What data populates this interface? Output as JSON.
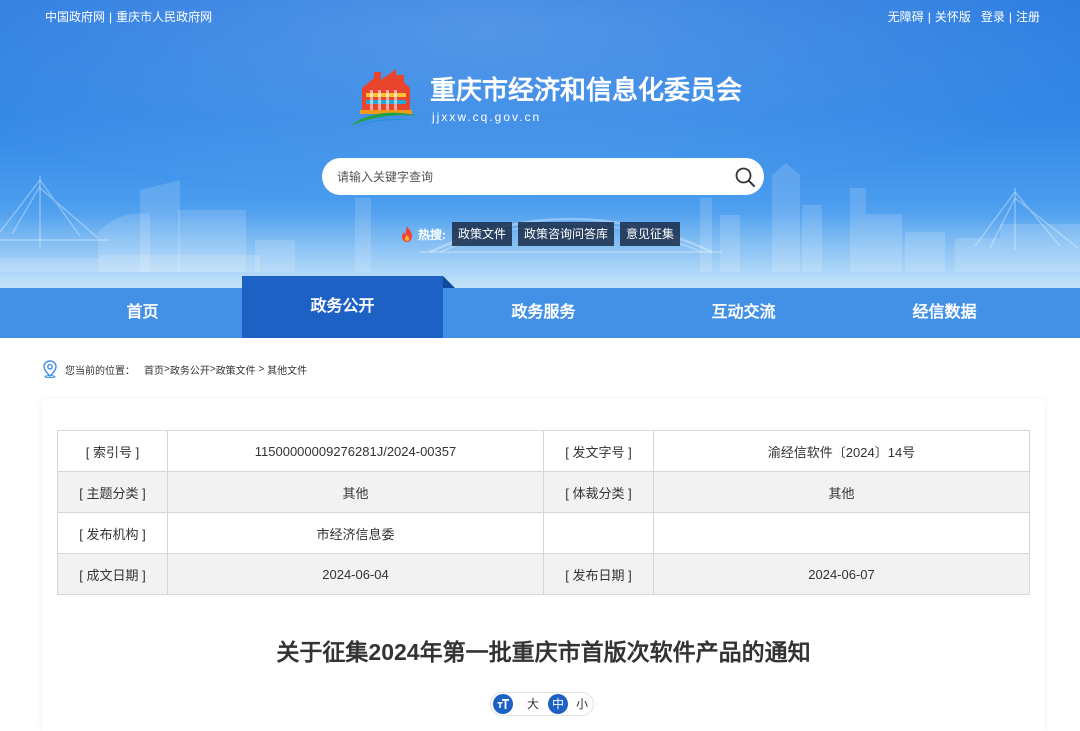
{
  "topbar": {
    "separator": "|",
    "left_links": [
      "中国政府网",
      "重庆市人民政府网"
    ],
    "right_group_1": [
      "无障碍",
      "关怀版"
    ],
    "right_group_2": [
      "登录",
      "注册"
    ]
  },
  "header": {
    "logo_icon": "cq-jjxxw-logo",
    "title": "重庆市经济和信息化委员会",
    "domain": "jjxxw.cq.gov.cn"
  },
  "search": {
    "placeholder": "请输入关键字查询",
    "value": "",
    "icon": "search-icon"
  },
  "hot_search": {
    "icon": "fire-icon",
    "label": "热搜:",
    "tags": [
      "政策文件",
      "政策咨询问答库",
      "意见征集"
    ]
  },
  "nav": {
    "items": [
      {
        "label": "首页",
        "active": false
      },
      {
        "label": "政务公开",
        "active": true
      },
      {
        "label": "政务服务",
        "active": false
      },
      {
        "label": "互动交流",
        "active": false
      },
      {
        "label": "经信数据",
        "active": false
      }
    ]
  },
  "breadcrumb": {
    "icon": "location-pin-icon",
    "prefix": "您当前的位置：",
    "items": [
      "首页",
      "政务公开",
      "政策文件",
      "其他文件"
    ],
    "separators": [
      ">",
      ">",
      " > "
    ]
  },
  "meta_table": {
    "rows": [
      {
        "label1": "[ 索引号 ]",
        "value1": "11500000009276281J/2024-00357",
        "label2": "[ 发文字号 ]",
        "value2": "渝经信软件〔2024〕14号"
      },
      {
        "label1": "[ 主题分类 ]",
        "value1": "其他",
        "label2": "[ 体裁分类 ]",
        "value2": "其他"
      },
      {
        "label1": "[ 发布机构 ]",
        "value1": "市经济信息委",
        "label2": "",
        "value2": ""
      },
      {
        "label1": "[ 成文日期 ]",
        "value1": "2024-06-04",
        "label2": "[ 发布日期 ]",
        "value2": "2024-06-07"
      }
    ]
  },
  "article": {
    "title": "关于征集2024年第一批重庆市首版次软件产品的通知"
  },
  "font_size": {
    "icon": "font-size-icon",
    "options": [
      "大",
      "中",
      "小"
    ],
    "selected": "中"
  },
  "colors": {
    "primary": "#1c61c3",
    "nav": "#4291e6",
    "banner": "#2b7ce0"
  }
}
